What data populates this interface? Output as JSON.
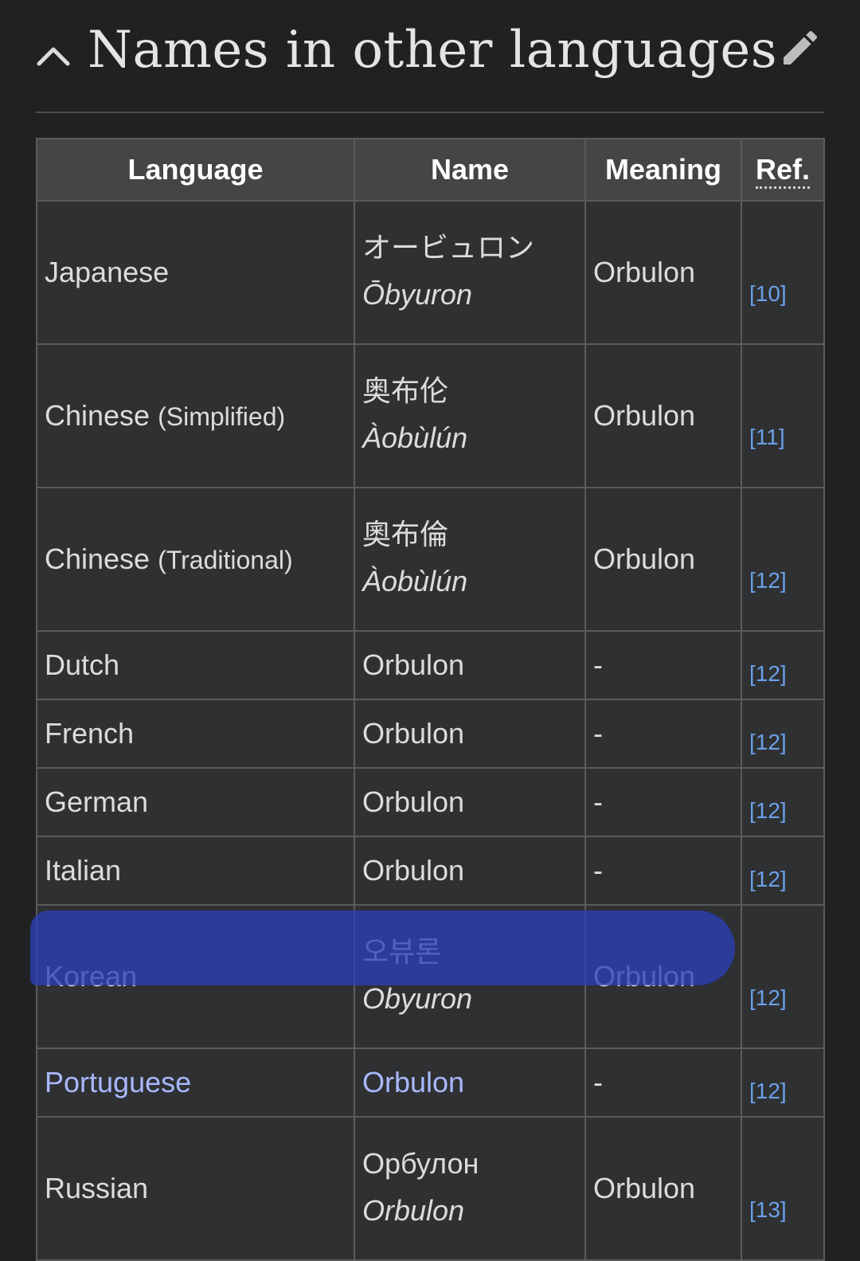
{
  "section": {
    "title": "Names in other languages",
    "collapse_icon": "chevron-up-icon",
    "edit_icon": "pencil-icon"
  },
  "table": {
    "headers": {
      "language": "Language",
      "name": "Name",
      "meaning": "Meaning",
      "ref": "Ref."
    },
    "rows": [
      {
        "language": "Japanese",
        "language_note": "",
        "name_native": "オービュロン",
        "name_roman": "Ōbyuron",
        "meaning": "Orbulon",
        "ref": "[10]"
      },
      {
        "language": "Chinese",
        "language_note": "(Simplified)",
        "name_native": "奥布伦",
        "name_roman": "Àobùlún",
        "meaning": "Orbulon",
        "ref": "[11]"
      },
      {
        "language": "Chinese",
        "language_note": "(Traditional)",
        "name_native": "奧布倫",
        "name_roman": "Àobùlún",
        "meaning": "Orbulon",
        "ref": "[12]"
      },
      {
        "language": "Dutch",
        "name": "Orbulon",
        "meaning": "-",
        "ref": "[12]"
      },
      {
        "language": "French",
        "name": "Orbulon",
        "meaning": "-",
        "ref": "[12]"
      },
      {
        "language": "German",
        "name": "Orbulon",
        "meaning": "-",
        "ref": "[12]"
      },
      {
        "language": "Italian",
        "name": "Orbulon",
        "meaning": "-",
        "ref": "[12]"
      },
      {
        "language": "Korean",
        "language_note": "",
        "name_native": "오뷰론",
        "name_roman": "Obyuron",
        "meaning": "Orbulon",
        "ref": "[12]"
      },
      {
        "language": "Portuguese",
        "name": "Orbulon",
        "meaning": "-",
        "ref": "[12]"
      },
      {
        "language": "Russian",
        "language_note": "",
        "name_native": "Орбулон",
        "name_roman": "Orbulon",
        "meaning": "Orbulon",
        "ref": "[13]"
      }
    ]
  },
  "colors": {
    "background": "#202122",
    "header_bg": "#444547",
    "cell_bg": "#2f3032",
    "link": "#6aa0e8",
    "highlight": "#2b3fb5"
  }
}
